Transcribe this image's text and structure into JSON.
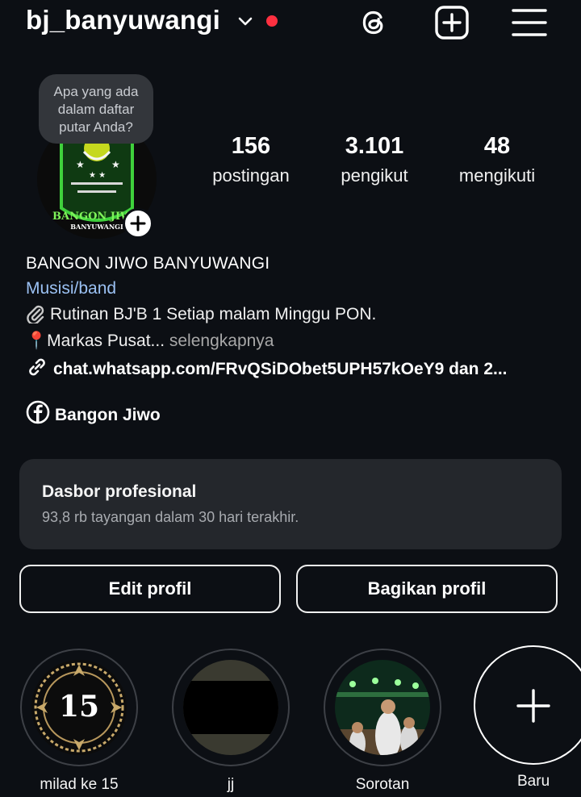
{
  "header": {
    "username": "bj_banyuwangi",
    "icons": [
      "chevron-down-icon",
      "notification-dot",
      "threads-icon",
      "add-post-icon",
      "menu-icon"
    ]
  },
  "note": {
    "lines": [
      "Apa yang ada",
      "dalam daftar",
      "putar Anda?"
    ]
  },
  "avatar": {
    "text_top": "BANGON JIWO",
    "text_bottom": "BANYUWANGI"
  },
  "stats": [
    {
      "value": "156",
      "label": "postingan"
    },
    {
      "value": "3.101",
      "label": "pengikut"
    },
    {
      "value": "48",
      "label": "mengikuti"
    }
  ],
  "bio": {
    "name": "BANGON JIWO BANYUWANGI",
    "category": "Musisi/band",
    "line1": "Rutinan BJ'B 1 Setiap malam Minggu PON.",
    "line2_emoji": "📍",
    "line2": "Markas Pusat...",
    "more": " selengkapnya",
    "link": "chat.whatsapp.com/FRvQSiDObet5UPH57kOeY9 dan 2...",
    "facebook": "Bangon Jiwo"
  },
  "dashboard": {
    "title": "Dasbor profesional",
    "subtitle": "93,8 rb tayangan dalam 30 hari terakhir."
  },
  "buttons": {
    "edit": "Edit profil",
    "share": "Bagikan profil"
  },
  "highlights": [
    {
      "label": "milad ke 15",
      "badge": "15"
    },
    {
      "label": "jj"
    },
    {
      "label": "Sorotan"
    }
  ],
  "new_highlight": {
    "label": "Baru"
  },
  "colors": {
    "background": "#0c0f14",
    "link_blue": "#9bc1f3",
    "notification_red": "#ff3040",
    "card": "#24272c"
  }
}
